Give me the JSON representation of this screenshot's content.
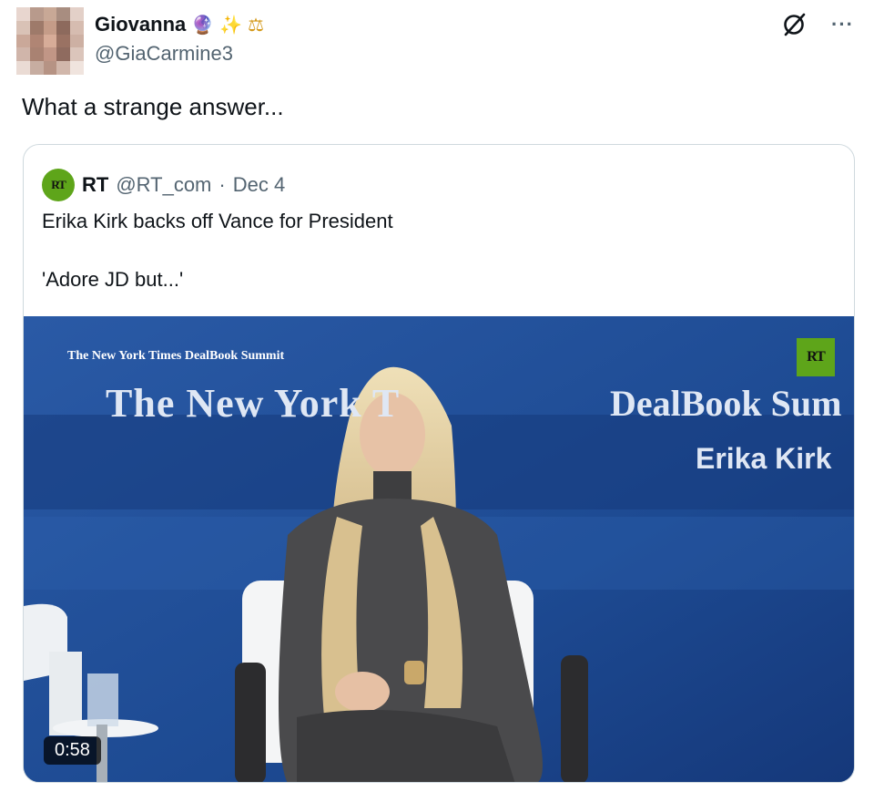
{
  "tweet": {
    "author_name": "Giovanna",
    "author_emojis": [
      "🔮",
      "✨",
      "⚖"
    ],
    "author_handle": "@GiaCarmine3",
    "text": "What a strange answer...",
    "icons": {
      "grok": "grok-icon",
      "more": "more-icon"
    }
  },
  "quote": {
    "author_name": "RT",
    "author_handle": "@RT_com",
    "separator": "·",
    "date": "Dec 4",
    "badge_text": "RT",
    "lines": [
      "Erika Kirk backs off Vance for President",
      "'Adore JD but...'"
    ],
    "video": {
      "banner_small": "The New York Times DealBook Summit",
      "banner_large_left": "The New York T",
      "banner_large_right": "DealBook Sum",
      "speaker_name": "Erika Kirk",
      "logo_text": "RT",
      "duration": "0:58"
    }
  },
  "colors": {
    "text_primary": "#0f1419",
    "text_secondary": "#536471",
    "border": "#cfd9de",
    "rt_green": "#5ea51a",
    "video_blue": "#1f4f96"
  }
}
